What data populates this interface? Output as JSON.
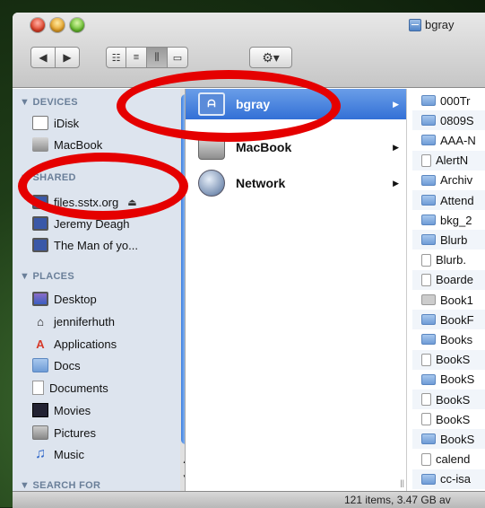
{
  "window": {
    "title": "bgray"
  },
  "toolbar": {
    "back_label": "◀",
    "forward_label": "▶",
    "view_icon": "☷",
    "view_list": "≡",
    "view_columns": "⫼",
    "view_coverflow": "▭",
    "gear_label": "⚙▾"
  },
  "sidebar": {
    "devices_header": "▼ DEVICES",
    "devices": [
      "iDisk",
      "MacBook"
    ],
    "shared_header": "▼ SHARED",
    "shared": [
      "files.sstx.org",
      "Jeremy Deagh",
      "The Man of yo..."
    ],
    "places_header": "▼ PLACES",
    "places": [
      "Desktop",
      "jenniferhuth",
      "Applications",
      "Docs",
      "Documents",
      "Movies",
      "Pictures",
      "Music"
    ],
    "search_header": "▼ SEARCH FOR"
  },
  "column2": {
    "items": [
      "bgray",
      "MacBook",
      "Network"
    ]
  },
  "column3": {
    "items": [
      "000Tr",
      "0809S",
      "AAA-N",
      "AlertN",
      "Archiv",
      "Attend",
      "bkg_2",
      "Blurb",
      "Blurb.",
      "Boarde",
      "Book1",
      "BookF",
      "Books",
      "BookS",
      "BookS",
      "BookS",
      "BookS",
      "BookS",
      "calend",
      "cc-isa"
    ]
  },
  "status": {
    "text": "121 items, 3.47 GB av"
  },
  "colors": {
    "selection": "#3370d6",
    "annotation": "#e50000"
  }
}
